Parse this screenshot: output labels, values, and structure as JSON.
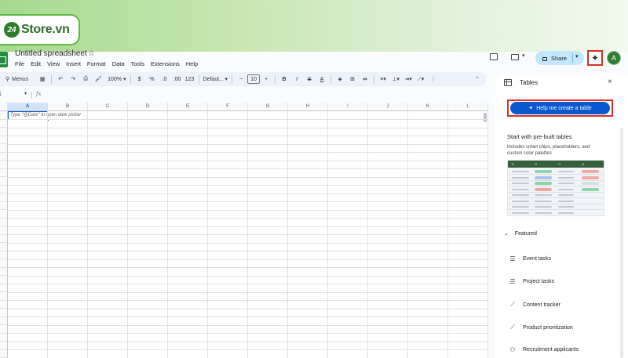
{
  "watermark": {
    "logo_number": "24",
    "logo_text": "Store.vn"
  },
  "header": {
    "doc_title": "Untitled spreadsheet",
    "menu": [
      "File",
      "Edit",
      "View",
      "Insert",
      "Format",
      "Data",
      "Tools",
      "Extensions",
      "Help"
    ],
    "share_label": "Share",
    "avatar_initial": "A"
  },
  "toolbar": {
    "menus_label": "Menus",
    "zoom": "100%",
    "currency": "$",
    "percent": "%",
    "dec_decrease": ".0",
    "dec_increase": ".00",
    "number_format": "123",
    "font": "Defaul...",
    "font_size": "10",
    "bold": "B",
    "italic": "I",
    "strike": "S",
    "text_color": "A"
  },
  "formula_bar": {
    "cell_ref": "1",
    "fx": "fx"
  },
  "grid": {
    "columns": [
      "A",
      "B",
      "C",
      "D",
      "E",
      "F",
      "G",
      "H",
      "I",
      "J",
      "K",
      "L"
    ],
    "selected_column": "A",
    "cell_hint": "Type \"@Date\" to open date picker"
  },
  "panel": {
    "title": "Tables",
    "close": "×",
    "help_button": "Help me create a table",
    "prebuilt_title": "Start with pre-built tables",
    "prebuilt_sub": "Includes smart chips, placeholders, and custom color palettes",
    "preview_headers": [
      "Tt",
      "⊙",
      "⚇",
      "⊙"
    ],
    "featured_label": "Featured",
    "featured_items": [
      {
        "icon": "checklist-icon",
        "label": "Event tasks"
      },
      {
        "icon": "checklist-icon",
        "label": "Project tasks"
      },
      {
        "icon": "trend-icon",
        "label": "Content tracker"
      },
      {
        "icon": "trend-icon",
        "label": "Product prioritization"
      },
      {
        "icon": "person-icon",
        "label": "Recruitment applicants"
      }
    ]
  },
  "colors": {
    "accent": "#0b57d0",
    "highlight_red": "#d93025",
    "share_bg": "#c2e7ff",
    "sheets_green": "#1e8e3e"
  }
}
